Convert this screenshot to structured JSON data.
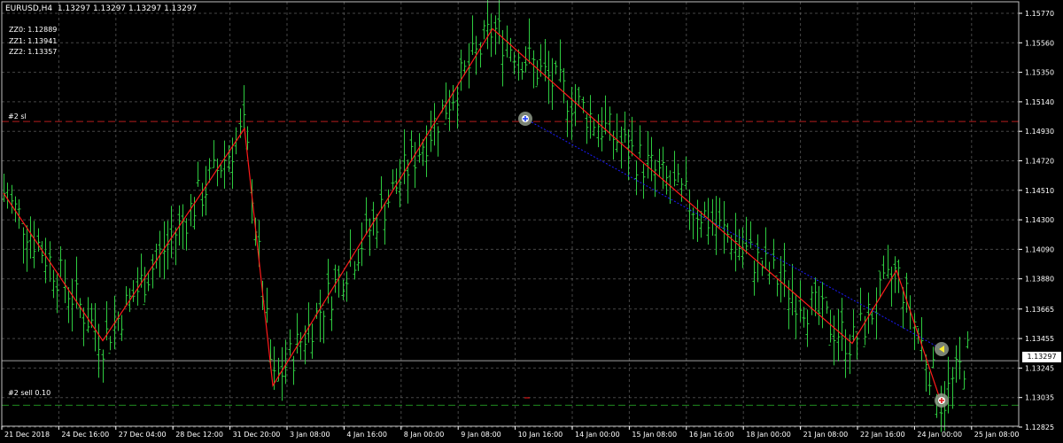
{
  "header": {
    "symbol": "EURUSD,H4",
    "ohlc": "1.13297 1.13297 1.13297 1.13297",
    "zz0": "ZZ0: 1.12889",
    "zz1": "ZZ1: 1.13941",
    "zz2": "ZZ2: 1.13357"
  },
  "levels": {
    "sl_label": "#2 sl",
    "sell_label": "#2 sell 0.10",
    "current_price": "1.13297"
  },
  "colors": {
    "background": "#000000",
    "grid": "#808080",
    "bars": "#2ecc40",
    "zigzag": "#ff1a1a",
    "sl_line": "#b41e1e",
    "sell_line": "#1f8a1f",
    "trend_line": "#1a1aff",
    "axis_text": "#ffffff"
  },
  "icons": {
    "entry_marker": "buy-arrow-icon",
    "mid_marker": "left-arrow-icon",
    "exit_marker": "sell-arrow-icon"
  },
  "chart_data": {
    "type": "bar",
    "title": "",
    "y_axis": [
      "1.15770",
      "1.15560",
      "1.15350",
      "1.15140",
      "1.14930",
      "1.14720",
      "1.14510",
      "1.14300",
      "1.14090",
      "1.13880",
      "1.13665",
      "1.13455",
      "1.13245",
      "1.13035",
      "1.12825"
    ],
    "x_axis": [
      "21 Dec 2018",
      "24 Dec 16:00",
      "27 Dec 04:00",
      "28 Dec 12:00",
      "31 Dec 20:00",
      "3 Jan 08:00",
      "4 Jan 16:00",
      "8 Jan 00:00",
      "9 Jan 08:00",
      "10 Jan 16:00",
      "14 Jan 00:00",
      "15 Jan 08:00",
      "16 Jan 16:00",
      "18 Jan 00:00",
      "21 Jan 08:00",
      "22 Jan 16:00",
      "24 Jan 00:00",
      "25 Jan 08:00"
    ],
    "ylim": [
      1.1272,
      1.1587
    ],
    "zigzag_prices": [
      1.1449,
      1.1344,
      1.1495,
      1.1312,
      1.1566,
      1.1485,
      1.1342,
      1.1394,
      1.1299
    ],
    "sl_price": 1.15,
    "sell_price": 1.1298,
    "current_price": 1.13297
  }
}
